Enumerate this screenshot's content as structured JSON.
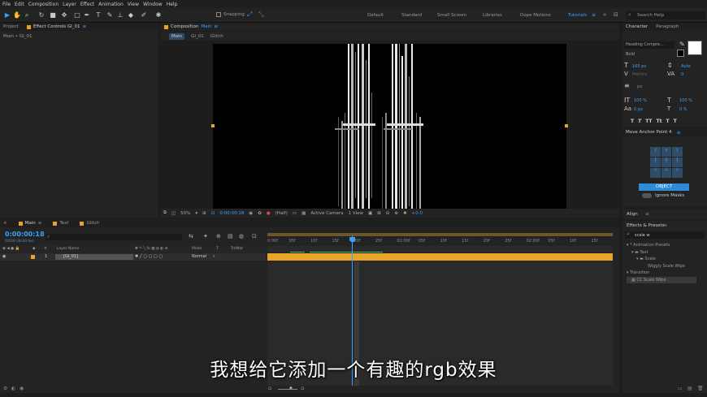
{
  "menu": [
    "File",
    "Edit",
    "Composition",
    "Layer",
    "Effect",
    "Animation",
    "View",
    "Window",
    "Help"
  ],
  "toolbar": {
    "snapping": "Snapping",
    "workspaces": [
      "Default",
      "Standard",
      "Small Screen",
      "Libraries",
      "Dope Motions",
      "Tutorials"
    ],
    "active_workspace": "Tutorials",
    "search_placeholder": "Search Help"
  },
  "project_panel": {
    "tabs": [
      "Project",
      "Effect Controls GI_01"
    ],
    "breadcrumb": "Main • GI_01"
  },
  "composition_panel": {
    "tab_title": "Composition",
    "tab_comp": "Main",
    "subtabs": [
      "Main",
      "GI_01",
      "Glitch"
    ],
    "zoom": "50%",
    "timecode": "0:00:00:18",
    "resolution": "(Half)",
    "camera": "Active Camera",
    "view": "1 View",
    "exposure": "+0.0"
  },
  "character_panel": {
    "tabs": [
      "Character",
      "Paragraph"
    ],
    "font": "Heading Compre...",
    "style": "Bold",
    "size": "165 px",
    "leading": "Auto",
    "kerning": "Metrics",
    "tracking": "0",
    "stroke_unit": "px",
    "vscale": "100 %",
    "hscale": "100 %",
    "baseline": "0 px",
    "tsume": "0 %",
    "style_buttons": [
      "T",
      "T",
      "TT",
      "Tt",
      "T",
      "T",
      "T",
      "T"
    ]
  },
  "anchor_panel": {
    "title": "Move Anchor Point 4",
    "object_button": "OBJECT",
    "ignore_masks": "Ignore Masks"
  },
  "align_panel": {
    "title": "Align"
  },
  "effects_panel": {
    "title": "Effects & Presets",
    "search_value": "scale w",
    "tree": [
      {
        "label": "* Animation Presets",
        "depth": 0
      },
      {
        "label": "Text",
        "depth": 1
      },
      {
        "label": "Scale",
        "depth": 2
      },
      {
        "label": "Wiggly Scale Wipe",
        "depth": 3
      },
      {
        "label": "Transition",
        "depth": 0
      },
      {
        "label": "CC Scale Wipe",
        "depth": 1
      }
    ]
  },
  "timeline": {
    "tabs": [
      "Main",
      "Text",
      "Glitch"
    ],
    "timecode": "0:00:00:18",
    "fps_info": "00018 (30.00 fps)",
    "columns": [
      "#",
      "Layer Name",
      "Mode",
      "T",
      "TrkMat"
    ],
    "layer": {
      "index": "1",
      "name": "[GI_01]",
      "mode": "Normal"
    },
    "ruler": [
      "0:00f",
      "05f",
      "10f",
      "15f",
      "20f",
      "25f",
      "01:00f",
      "05f",
      "10f",
      "15f",
      "20f",
      "25f",
      "02:00f",
      "05f",
      "10f",
      "15f"
    ],
    "playhead_fraction": 0.245
  },
  "subtitle": "我想给它添加一个有趣的rgb效果",
  "colors": {
    "accent_blue": "#3aa0ff",
    "layer_bar": "#e8a32a",
    "label_orange": "#e8a32a"
  }
}
